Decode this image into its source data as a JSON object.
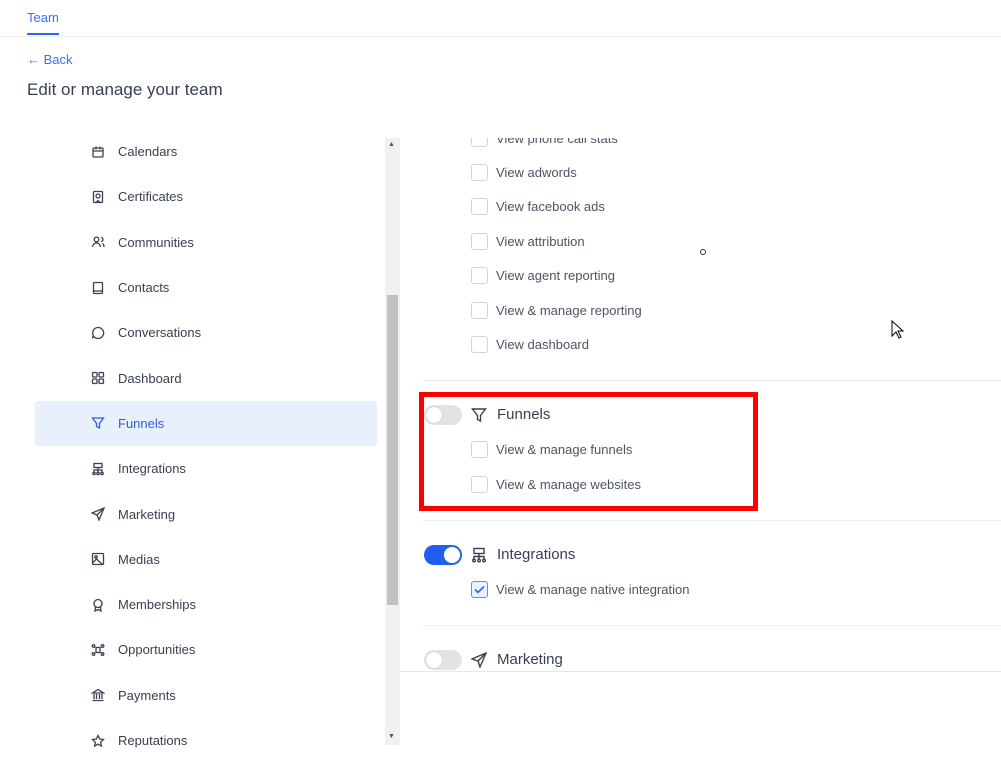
{
  "tabs": [
    {
      "label": "Team",
      "active": true
    }
  ],
  "back_label": "Back",
  "page_title": "Edit or manage your team",
  "accent_color": "#2f66f0",
  "highlight_color": "#ff0000",
  "sidebar": {
    "items": [
      {
        "label": "Calendars",
        "icon": "calendar-icon"
      },
      {
        "label": "Certificates",
        "icon": "certificate-icon"
      },
      {
        "label": "Communities",
        "icon": "users-icon"
      },
      {
        "label": "Contacts",
        "icon": "book-icon"
      },
      {
        "label": "Conversations",
        "icon": "chat-icon"
      },
      {
        "label": "Dashboard",
        "icon": "grid-icon"
      },
      {
        "label": "Funnels",
        "icon": "funnel-icon",
        "active": true
      },
      {
        "label": "Integrations",
        "icon": "sitemap-icon"
      },
      {
        "label": "Marketing",
        "icon": "send-icon"
      },
      {
        "label": "Medias",
        "icon": "image-icon"
      },
      {
        "label": "Memberships",
        "icon": "award-icon"
      },
      {
        "label": "Opportunities",
        "icon": "pipeline-icon"
      },
      {
        "label": "Payments",
        "icon": "bank-icon"
      },
      {
        "label": "Reputations",
        "icon": "star-icon"
      }
    ]
  },
  "reporting": {
    "items": [
      {
        "label": "View phone call stats",
        "checked": false
      },
      {
        "label": "View adwords",
        "checked": false
      },
      {
        "label": "View facebook ads",
        "checked": false
      },
      {
        "label": "View attribution",
        "checked": false
      },
      {
        "label": "View agent reporting",
        "checked": false
      },
      {
        "label": "View & manage reporting",
        "checked": false
      },
      {
        "label": "View dashboard",
        "checked": false
      }
    ]
  },
  "funnels": {
    "title": "Funnels",
    "enabled": false,
    "items": [
      {
        "label": "View & manage funnels",
        "checked": false
      },
      {
        "label": "View & manage websites",
        "checked": false
      }
    ]
  },
  "integrations": {
    "title": "Integrations",
    "enabled": true,
    "items": [
      {
        "label": "View & manage native integration",
        "checked": true
      }
    ]
  },
  "marketing": {
    "title": "Marketing",
    "enabled": false
  }
}
